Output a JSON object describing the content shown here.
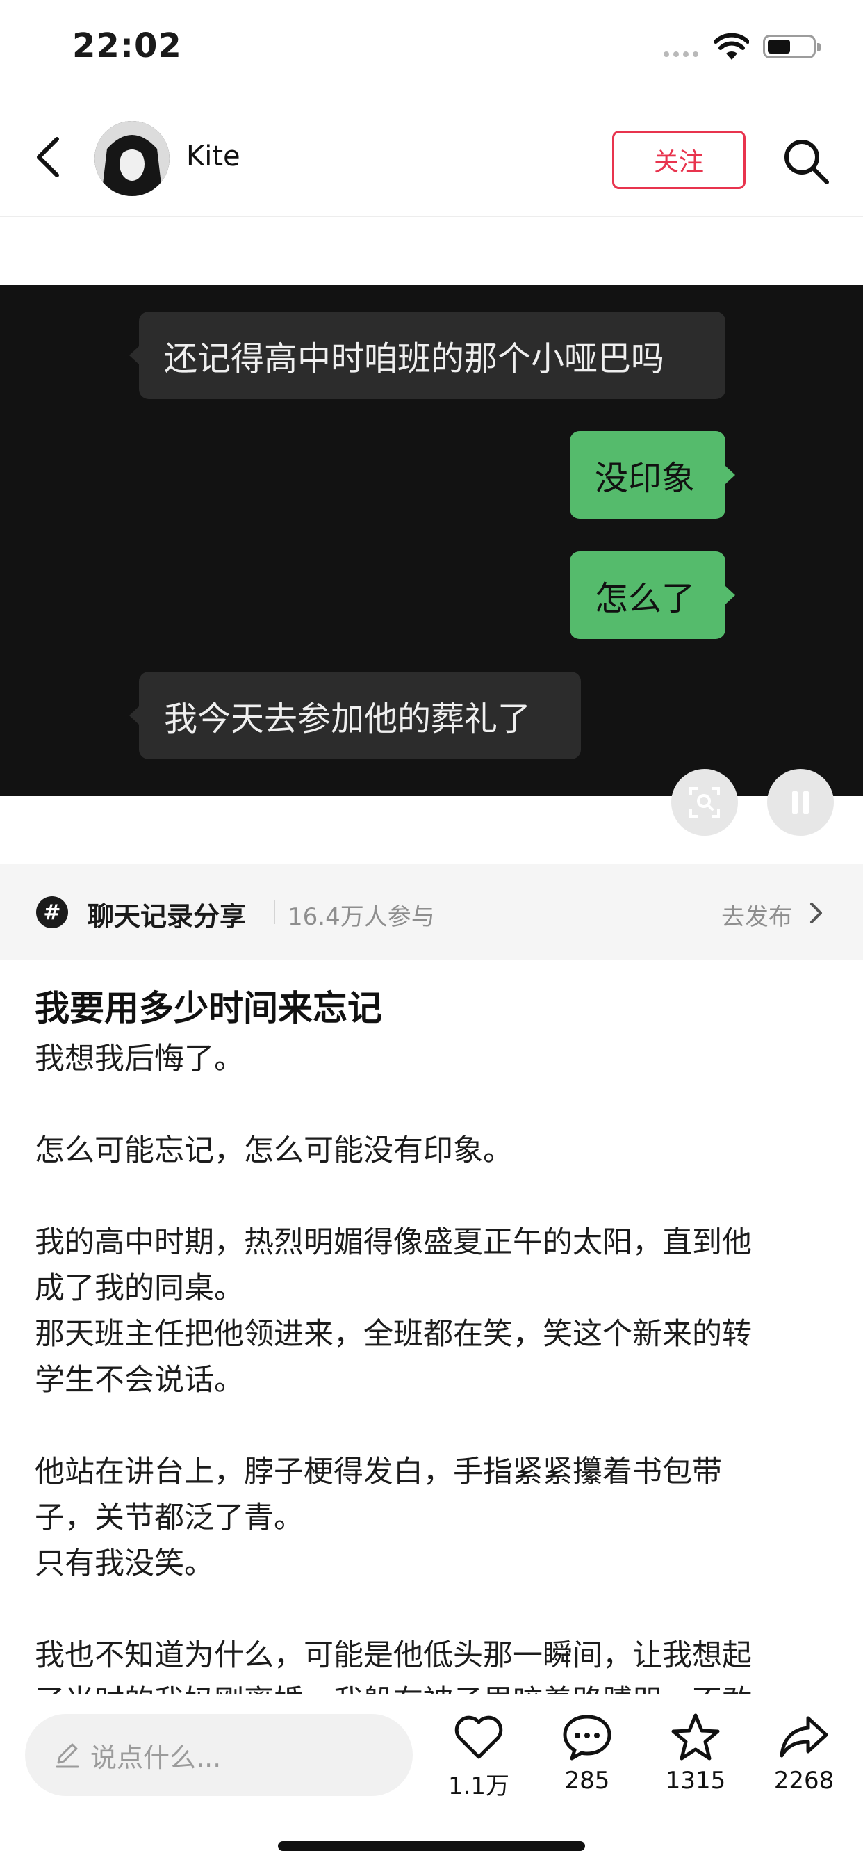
{
  "status_bar": {
    "time": "22:02"
  },
  "header": {
    "username": "Kite",
    "follow_label": "关注"
  },
  "chat": [
    {
      "side": "left",
      "text": "还记得高中时咱班的那个小哑巴吗"
    },
    {
      "side": "right",
      "text": "没印象"
    },
    {
      "side": "right",
      "text": "怎么了"
    },
    {
      "side": "left",
      "text": "我今天去参加他的葬礼了"
    }
  ],
  "topic": {
    "icon_text": "#",
    "name": "聊天记录分享",
    "participants": "16.4万人参与",
    "publish_label": "去发布"
  },
  "article": {
    "title": "我要用多少时间来忘记",
    "lines": [
      "我想我后悔了。",
      "",
      "怎么可能忘记，怎么可能没有印象。",
      "",
      "我的高中时期，热烈明媚得像盛夏正午的太阳，直到他",
      "成了我的同桌。",
      "那天班主任把他领进来，全班都在笑，笑这个新来的转",
      "学生不会说话。",
      "",
      "他站在讲台上，脖子梗得发白，手指紧紧攥着书包带",
      "子，关节都泛了青。",
      "只有我没笑。",
      "",
      "我也不知道为什么，可能是他低头那一瞬间，让我想起",
      "了当时的我妈刚离婚，我躲在被子里咬着路膊哭，不敢"
    ]
  },
  "bottom_bar": {
    "comment_placeholder": "说点什么...",
    "likes": "1.1万",
    "comments": "285",
    "favorites": "1315",
    "shares": "2268"
  },
  "colors": {
    "accent_red": "#e8344e",
    "chat_green": "#55bb6c",
    "video_bg": "#121212"
  }
}
